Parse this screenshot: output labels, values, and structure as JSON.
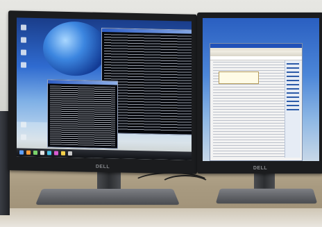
{
  "scene": {
    "description_labels": {
      "left_monitor_brand": "DELL",
      "right_monitor_brand": "DELL"
    },
    "colors": {
      "desk": "#a89a80",
      "wall": "#d8d9d4",
      "monitor_bezel": "#1b1c1e",
      "desktop_blue": "#2f6bd0"
    }
  }
}
